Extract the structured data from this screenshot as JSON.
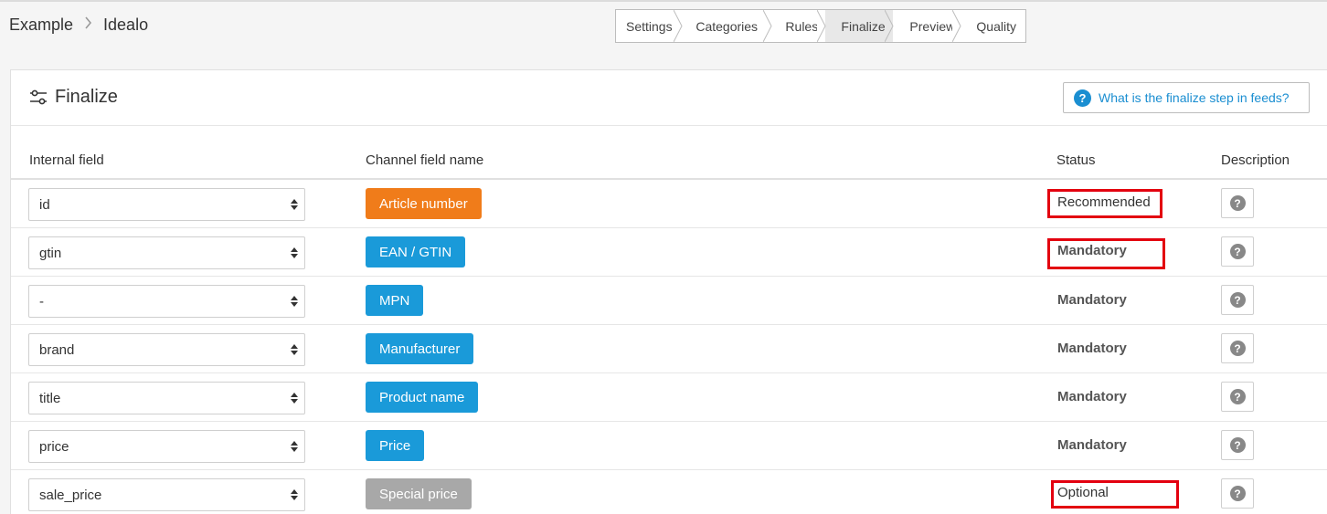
{
  "breadcrumb": {
    "items": [
      "Example",
      "Idealo"
    ]
  },
  "steps": [
    {
      "label": "Settings",
      "active": false
    },
    {
      "label": "Categories",
      "active": false
    },
    {
      "label": "Rules",
      "active": false
    },
    {
      "label": "Finalize",
      "active": true
    },
    {
      "label": "Preview",
      "active": false
    },
    {
      "label": "Quality",
      "active": false
    }
  ],
  "card": {
    "title": "Finalize",
    "help_label": "What is the finalize step in feeds?"
  },
  "table": {
    "headers": {
      "internal": "Internal field",
      "channel": "Channel field name",
      "status": "Status",
      "description": "Description"
    },
    "rows": [
      {
        "internal": "id",
        "channel": "Article number",
        "status": "Recommended"
      },
      {
        "internal": "gtin",
        "channel": "EAN / GTIN",
        "status": "Mandatory"
      },
      {
        "internal": "-",
        "channel": "MPN",
        "status": "Mandatory"
      },
      {
        "internal": "brand",
        "channel": "Manufacturer",
        "status": "Mandatory"
      },
      {
        "internal": "title",
        "channel": "Product name",
        "status": "Mandatory"
      },
      {
        "internal": "price",
        "channel": "Price",
        "status": "Mandatory"
      },
      {
        "internal": "sale_price",
        "channel": "Special price",
        "status": "Optional"
      }
    ]
  },
  "colors": {
    "recommended": "#f07c1a",
    "mandatory": "#1a9ad9",
    "optional": "#a8a8a8",
    "highlight": "#e3000f",
    "link": "#1a8ed1"
  },
  "icons": {
    "title_icon": "sliders-icon",
    "help_icon": "question-circle-icon",
    "desc_icon": "question-circle-icon",
    "select_icon": "sort-arrows-icon",
    "breadcrumb_sep": "chevron-right-icon"
  }
}
